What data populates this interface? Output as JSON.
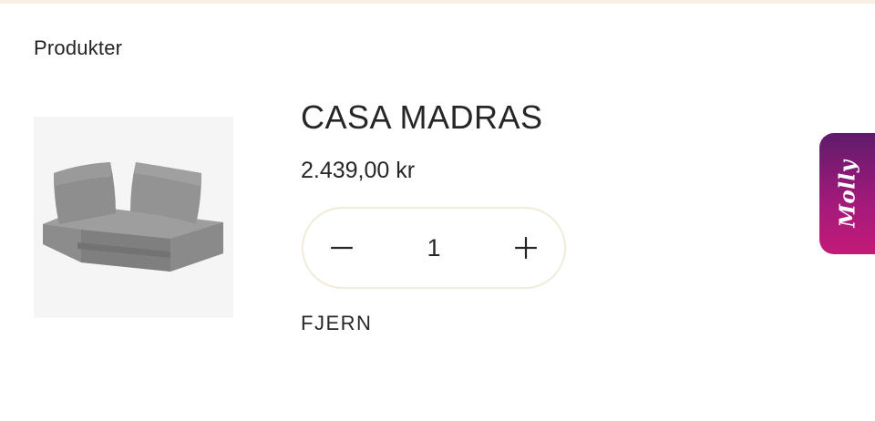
{
  "section": {
    "title": "Produkter"
  },
  "product": {
    "image_alt": "grey corner lounge cushion set",
    "name": "CASA MADRAS",
    "price": "2.439,00 kr",
    "quantity": "1",
    "remove_label": "FJERN"
  },
  "stepper": {
    "decrease_icon": "minus-icon",
    "increase_icon": "plus-icon"
  },
  "chat_widget": {
    "label": "Molly"
  },
  "colors": {
    "accent_border": "#f2eadb",
    "widget_gradient_top": "#5f1b6b",
    "widget_gradient_bottom": "#c41a78"
  }
}
